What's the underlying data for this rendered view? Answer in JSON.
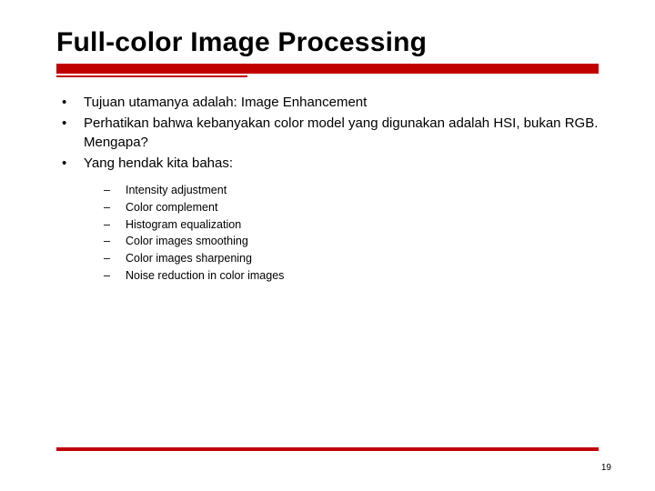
{
  "title": "Full-color Image Processing",
  "bullets": [
    {
      "text": "Tujuan utamanya adalah: Image Enhancement"
    },
    {
      "text": "Perhatikan bahwa kebanyakan color model yang digunakan adalah HSI, bukan RGB. Mengapa?"
    },
    {
      "text": "Yang hendak kita bahas:"
    }
  ],
  "subbullets": [
    {
      "text": "Intensity adjustment"
    },
    {
      "text": "Color complement"
    },
    {
      "text": "Histogram equalization"
    },
    {
      "text": "Color images smoothing"
    },
    {
      "text": "Color images sharpening"
    },
    {
      "text": "Noise reduction in color images"
    }
  ],
  "page_number": "19",
  "glyphs": {
    "bullet": "•",
    "dash": "–"
  }
}
